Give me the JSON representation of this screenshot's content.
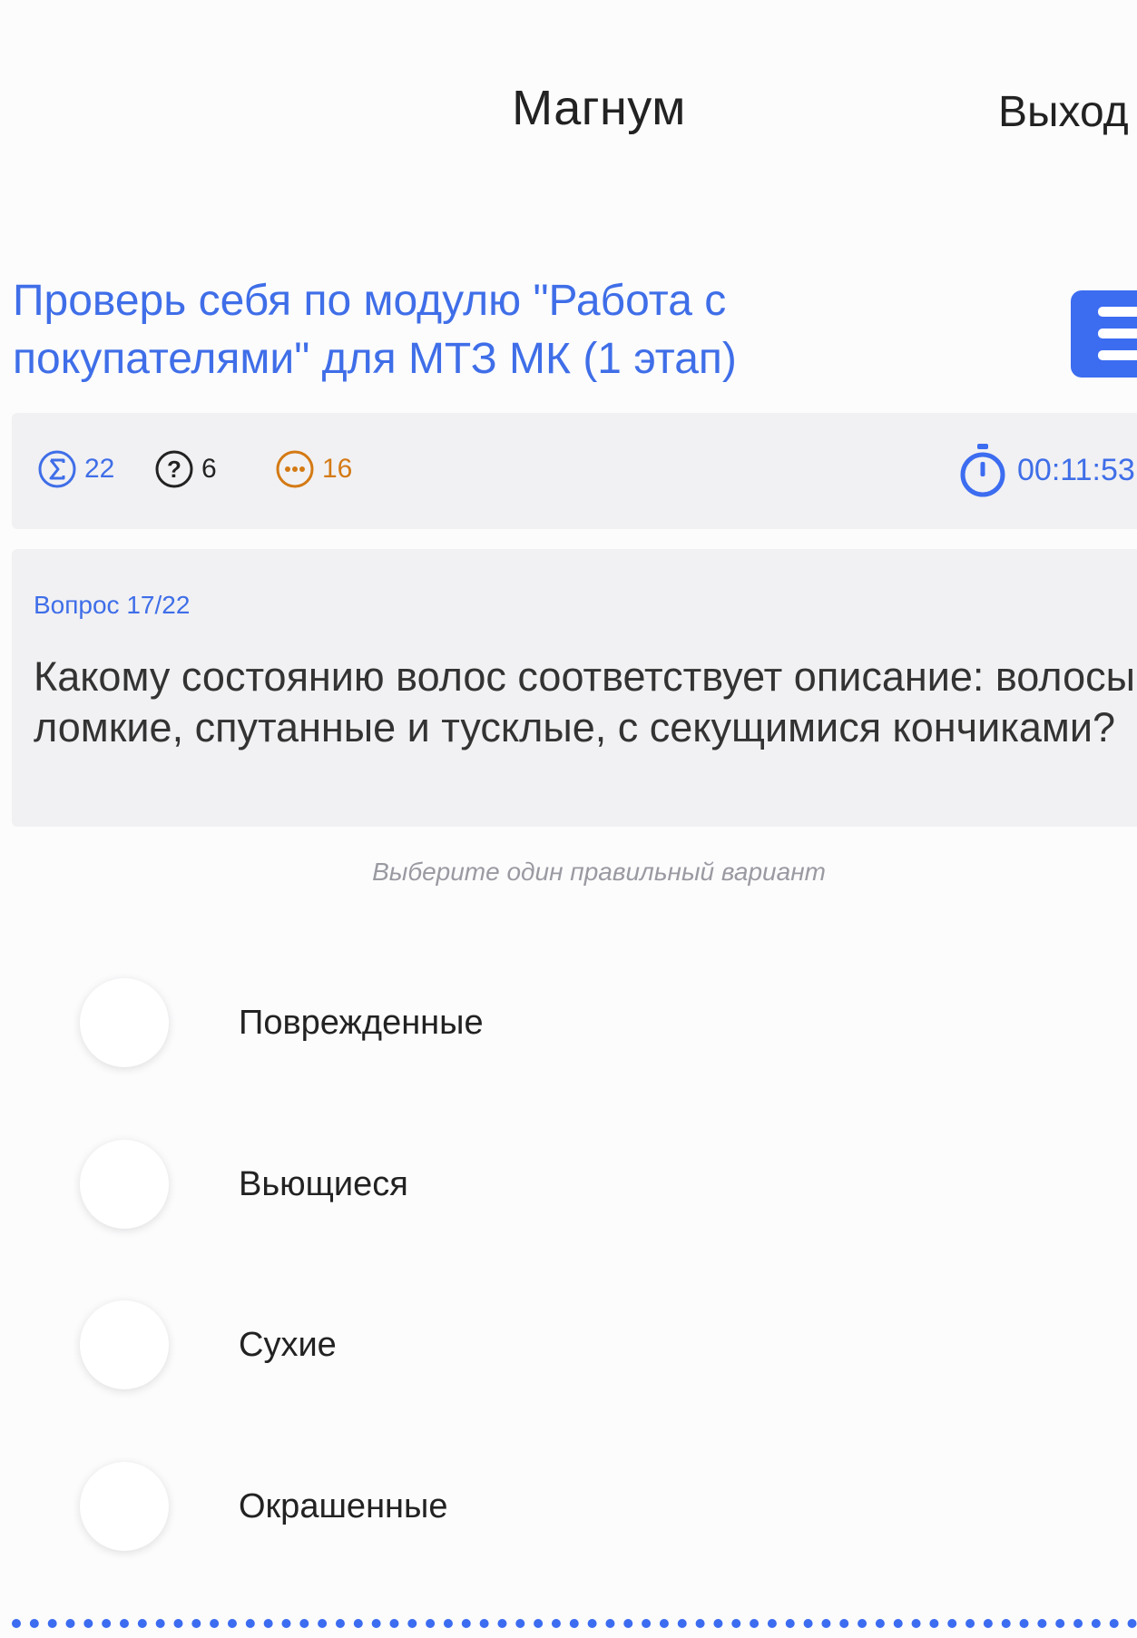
{
  "header": {
    "title": "Магнум",
    "exit_label": "Выход"
  },
  "test": {
    "title": " Проверь себя по модулю \"Работа с покупателями\" для МТЗ МК (1 этап)"
  },
  "stats": {
    "total": "22",
    "questions": "6",
    "remaining": "16",
    "timer": "00:11:53"
  },
  "question": {
    "number": "Вопрос 17/22",
    "text": "Какому состоянию волос соответствует описание: волосы ломкие, спутанные и тусклые, с секущимися кончиками?",
    "instruction": "Выберите один правильный вариант"
  },
  "options": [
    {
      "label": "Поврежденные",
      "selected": false
    },
    {
      "label": "Вьющиеся",
      "selected": false
    },
    {
      "label": "Сухие",
      "selected": false
    },
    {
      "label": "Окрашенные",
      "selected": false
    }
  ],
  "colors": {
    "accent": "#3c6cf0",
    "link_blue": "#3f6ee8",
    "orange": "#d47a14",
    "panel_bg": "#f1f1f3"
  },
  "icons": {
    "total": "sigma-circle-icon",
    "questions": "question-circle-icon",
    "remaining": "ellipsis-circle-icon",
    "timer": "stopwatch-icon",
    "menu": "hamburger-menu-icon"
  }
}
